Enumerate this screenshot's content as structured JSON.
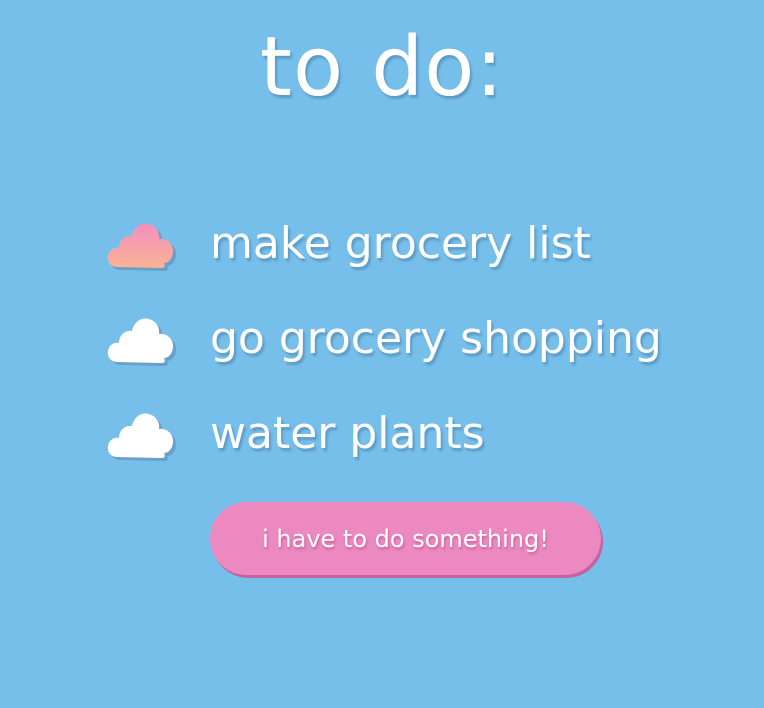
{
  "page": {
    "title": "to do:"
  },
  "todos": [
    {
      "label": "make grocery list",
      "icon": "cloud-icon",
      "state": "active",
      "color": "#f6a4a8"
    },
    {
      "label": "go grocery shopping",
      "icon": "cloud-icon",
      "state": "default",
      "color": "#ffffff"
    },
    {
      "label": "water plants",
      "icon": "cloud-icon",
      "state": "default",
      "color": "#ffffff"
    }
  ],
  "action": {
    "label": "i have to do something!",
    "color": "#ec89c1"
  },
  "colors": {
    "background": "#77bfeb",
    "text": "#ffffff",
    "active_cloud_top": "#f38fbf",
    "active_cloud_bottom": "#f9b394"
  }
}
